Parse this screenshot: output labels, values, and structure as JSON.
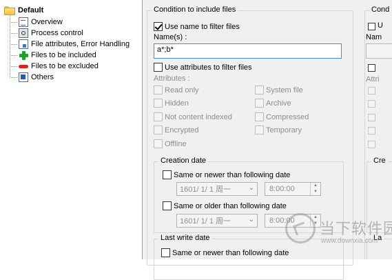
{
  "tree": {
    "root_label": "Default",
    "items": [
      {
        "label": "Overview",
        "icon": "overview-icon"
      },
      {
        "label": "Process control",
        "icon": "process-control-icon"
      },
      {
        "label": "File attributes, Error Handling",
        "icon": "file-attributes-icon"
      },
      {
        "label": "Files to be included",
        "icon": "green-plus-icon"
      },
      {
        "label": "Files to be excluded",
        "icon": "red-minus-icon"
      },
      {
        "label": "Others",
        "icon": "others-icon"
      }
    ]
  },
  "include": {
    "title": "Condition to include files",
    "use_name_label": "Use name to filter files",
    "use_name_checked": true,
    "names_label": "Name(s) :",
    "names_value": "a*;b*",
    "use_attributes_label": "Use attributes to filter files",
    "use_attributes_checked": false,
    "attributes_label": "Attributes :",
    "attributes_left": [
      "Read only",
      "Hidden",
      "Not content indexed",
      "Encrypted",
      "Offline"
    ],
    "attributes_right": [
      "System file",
      "Archive",
      "Compressed",
      "Temporary"
    ],
    "creation": {
      "title": "Creation date",
      "newer_label": "Same or newer than following date",
      "newer_date": "1601/  1/  1 周一",
      "newer_time": "8:00:00",
      "older_label": "Same or older than following date",
      "older_date": "1601/  1/  1 周一",
      "older_time": "8:00:00"
    },
    "last_write": {
      "title": "Last write date",
      "newer_label": "Same or newer than following date"
    }
  },
  "exclude_partial": {
    "title": "Cond",
    "name_label": "Nam",
    "attributes_label": "Attri",
    "creation_label": "Cre",
    "lastwrite_label": "La",
    "u_label": "U"
  },
  "watermark": {
    "cn_text": "当下软件园",
    "url": "www.downxia.com"
  }
}
